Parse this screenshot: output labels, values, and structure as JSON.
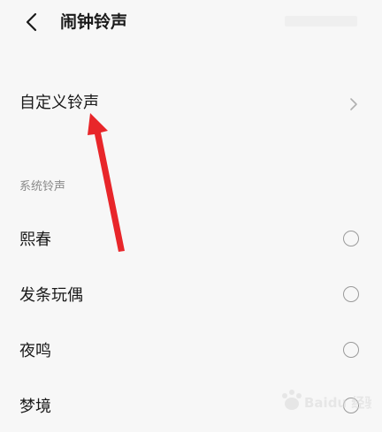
{
  "header": {
    "title": "闹钟铃声",
    "back_icon": "chevron-left-icon"
  },
  "custom_ringtone": {
    "label": "自定义铃声",
    "chevron_icon": "chevron-right-icon"
  },
  "system_section": {
    "header": "系统铃声",
    "items": [
      {
        "label": "熙春"
      },
      {
        "label": "发条玩偶"
      },
      {
        "label": "夜鸣"
      },
      {
        "label": "梦境"
      }
    ]
  },
  "colors": {
    "background": "#f7f7f7",
    "text": "#1a1a1a",
    "secondary_text": "#8a8a8a",
    "radio_border": "#9a9a9a",
    "annotation_arrow": "#e8262a"
  },
  "watermark": {
    "text": "Baidu 经验"
  }
}
